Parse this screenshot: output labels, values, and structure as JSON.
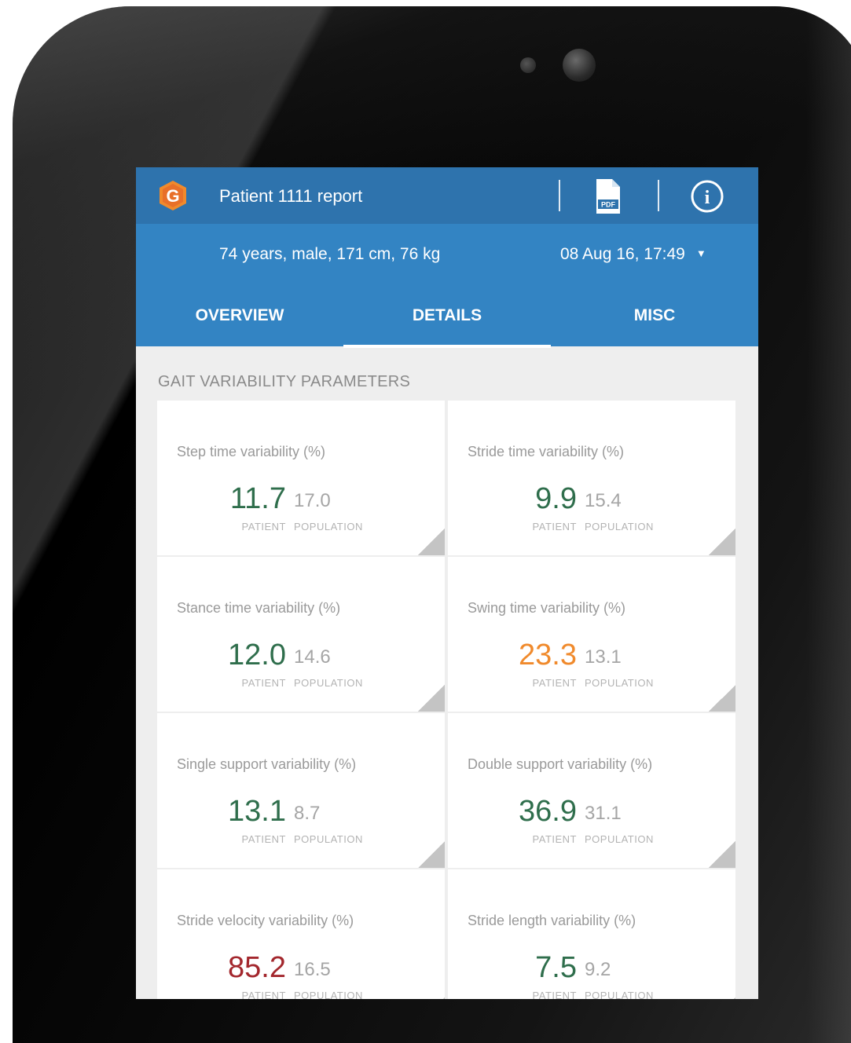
{
  "app": {
    "title": "Patient 1111 report",
    "logo_icon": "g-logo-icon",
    "logo_letter": "G",
    "pdf_icon": "pdf-document-icon",
    "pdf_glyph_text": "PDF",
    "info_icon": "info-circle-icon",
    "info_glyph": "i"
  },
  "patient": {
    "summary": "74 years, male, 171 cm, 76 kg",
    "session": "08 Aug 16, 17:49",
    "session_chevron": "▼"
  },
  "tabs": [
    {
      "label": "OVERVIEW",
      "active": false
    },
    {
      "label": "DETAILS",
      "active": true
    },
    {
      "label": "MISC",
      "active": false
    }
  ],
  "section": {
    "title": "GAIT VARIABILITY PARAMETERS"
  },
  "colors": {
    "primary_dark": "#2e73ad",
    "primary": "#3384c3",
    "value_green": "#2f6e4c",
    "value_orange": "#f08a2c",
    "value_red": "#a3272d"
  },
  "patient_label": "PATIENT",
  "population_label": "POPULATION",
  "cards": [
    {
      "label": "Step time variability (%)",
      "patient": "11.7",
      "population": "17.0",
      "status": "green"
    },
    {
      "label": "Stride time variability (%)",
      "patient": "9.9",
      "population": "15.4",
      "status": "green"
    },
    {
      "label": "Stance time variability (%)",
      "patient": "12.0",
      "population": "14.6",
      "status": "green"
    },
    {
      "label": "Swing time variability (%)",
      "patient": "23.3",
      "population": "13.1",
      "status": "orange"
    },
    {
      "label": "Single support variability (%)",
      "patient": "13.1",
      "population": "8.7",
      "status": "green"
    },
    {
      "label": "Double support variability (%)",
      "patient": "36.9",
      "population": "31.1",
      "status": "green"
    },
    {
      "label": "Stride velocity variability (%)",
      "patient": "85.2",
      "population": "16.5",
      "status": "red"
    },
    {
      "label": "Stride length variability (%)",
      "patient": "7.5",
      "population": "9.2",
      "status": "green"
    }
  ]
}
